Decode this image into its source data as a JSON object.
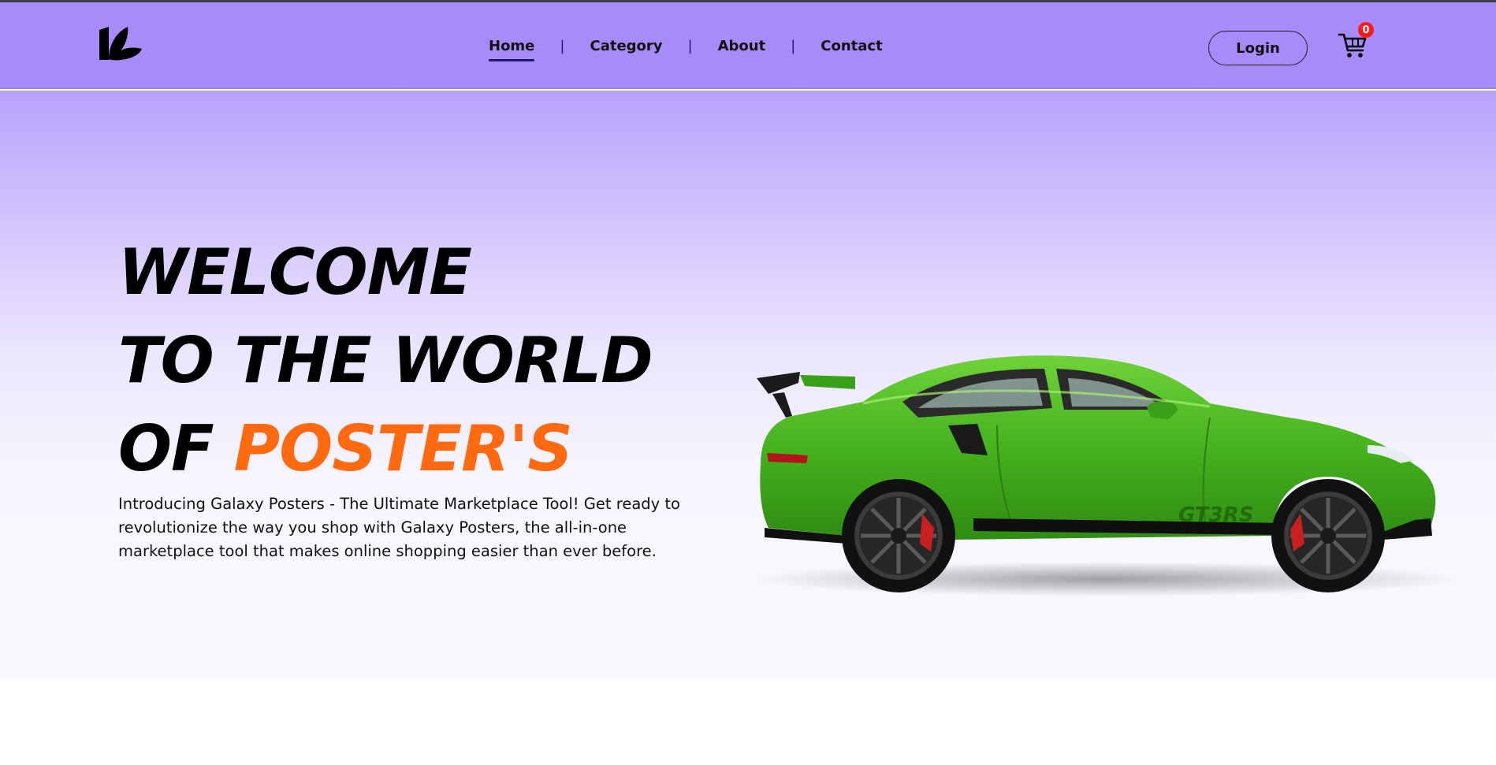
{
  "brand": {
    "logo_icon": "leaf-k-logo-icon"
  },
  "nav": {
    "items": [
      {
        "label": "Home",
        "active": true
      },
      {
        "label": "Category",
        "active": false
      },
      {
        "label": "About",
        "active": false
      },
      {
        "label": "Contact",
        "active": false
      }
    ],
    "separator": "|"
  },
  "header": {
    "login_label": "Login",
    "cart_icon": "cart-icon",
    "cart_count": "0"
  },
  "hero": {
    "line1": "WELCOME",
    "line2": "TO THE WORLD",
    "line3_prefix": "OF",
    "line3_accent": "POSTER'S",
    "description": "Introducing Galaxy Posters - The Ultimate Marketplace Tool! Get ready to revolutionize the way you shop with Galaxy Posters, the all-in-one marketplace tool that makes online shopping easier than ever before.",
    "image": "green-sports-car-image",
    "car_decal": "GT3RS"
  },
  "colors": {
    "navbar_bg": "#a78bfa",
    "accent_orange": "#ff6a10",
    "badge_red": "#ff1a1a",
    "car_green": "#4caf26"
  }
}
